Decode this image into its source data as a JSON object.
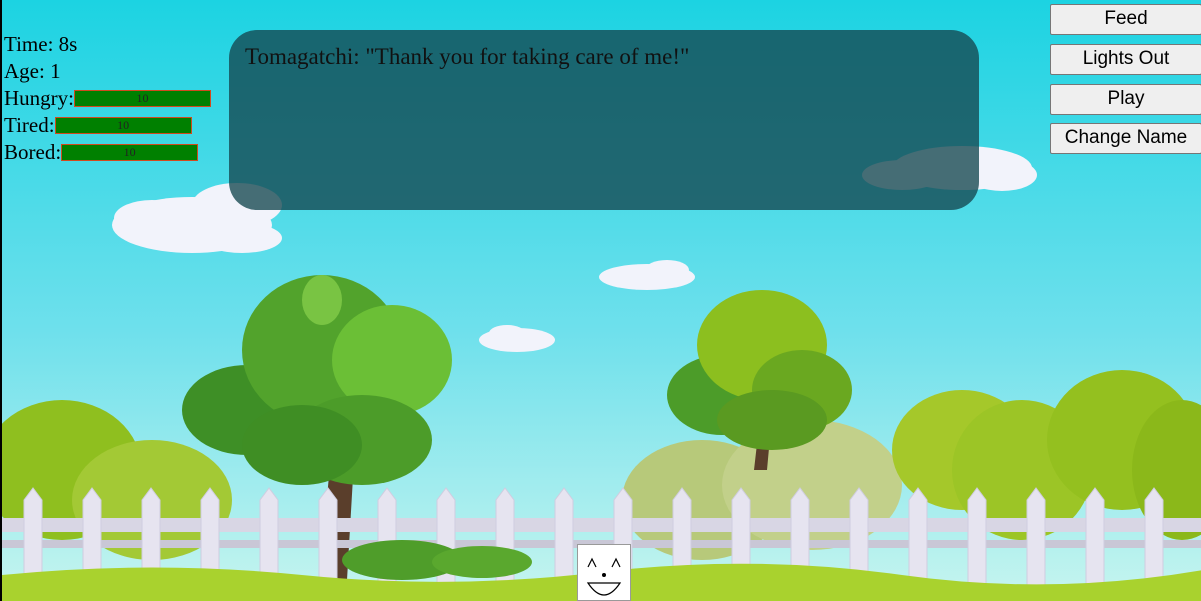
{
  "stats": {
    "time_label": "Time: 8s",
    "age_label": "Age: 1",
    "hungry_label": "Hungry:",
    "hungry_value": "10",
    "tired_label": "Tired:",
    "tired_value": "10",
    "bored_label": "Bored:",
    "bored_value": "10"
  },
  "dialog": {
    "text": "Tomagatchi: \"Thank you for taking care of me!\""
  },
  "buttons": {
    "feed": "Feed",
    "lights_out": "Lights Out",
    "play": "Play",
    "change_name": "Change Name"
  },
  "colors": {
    "sky_top": "#1cd3e2",
    "sky_bottom": "#b8f3ef",
    "bar_fill": "#008000",
    "bar_border": "#d2491f",
    "dialog_bg": "#14465099",
    "grass": "#9ccc2a"
  },
  "pet": {
    "icon": "smiling-face-icon"
  }
}
